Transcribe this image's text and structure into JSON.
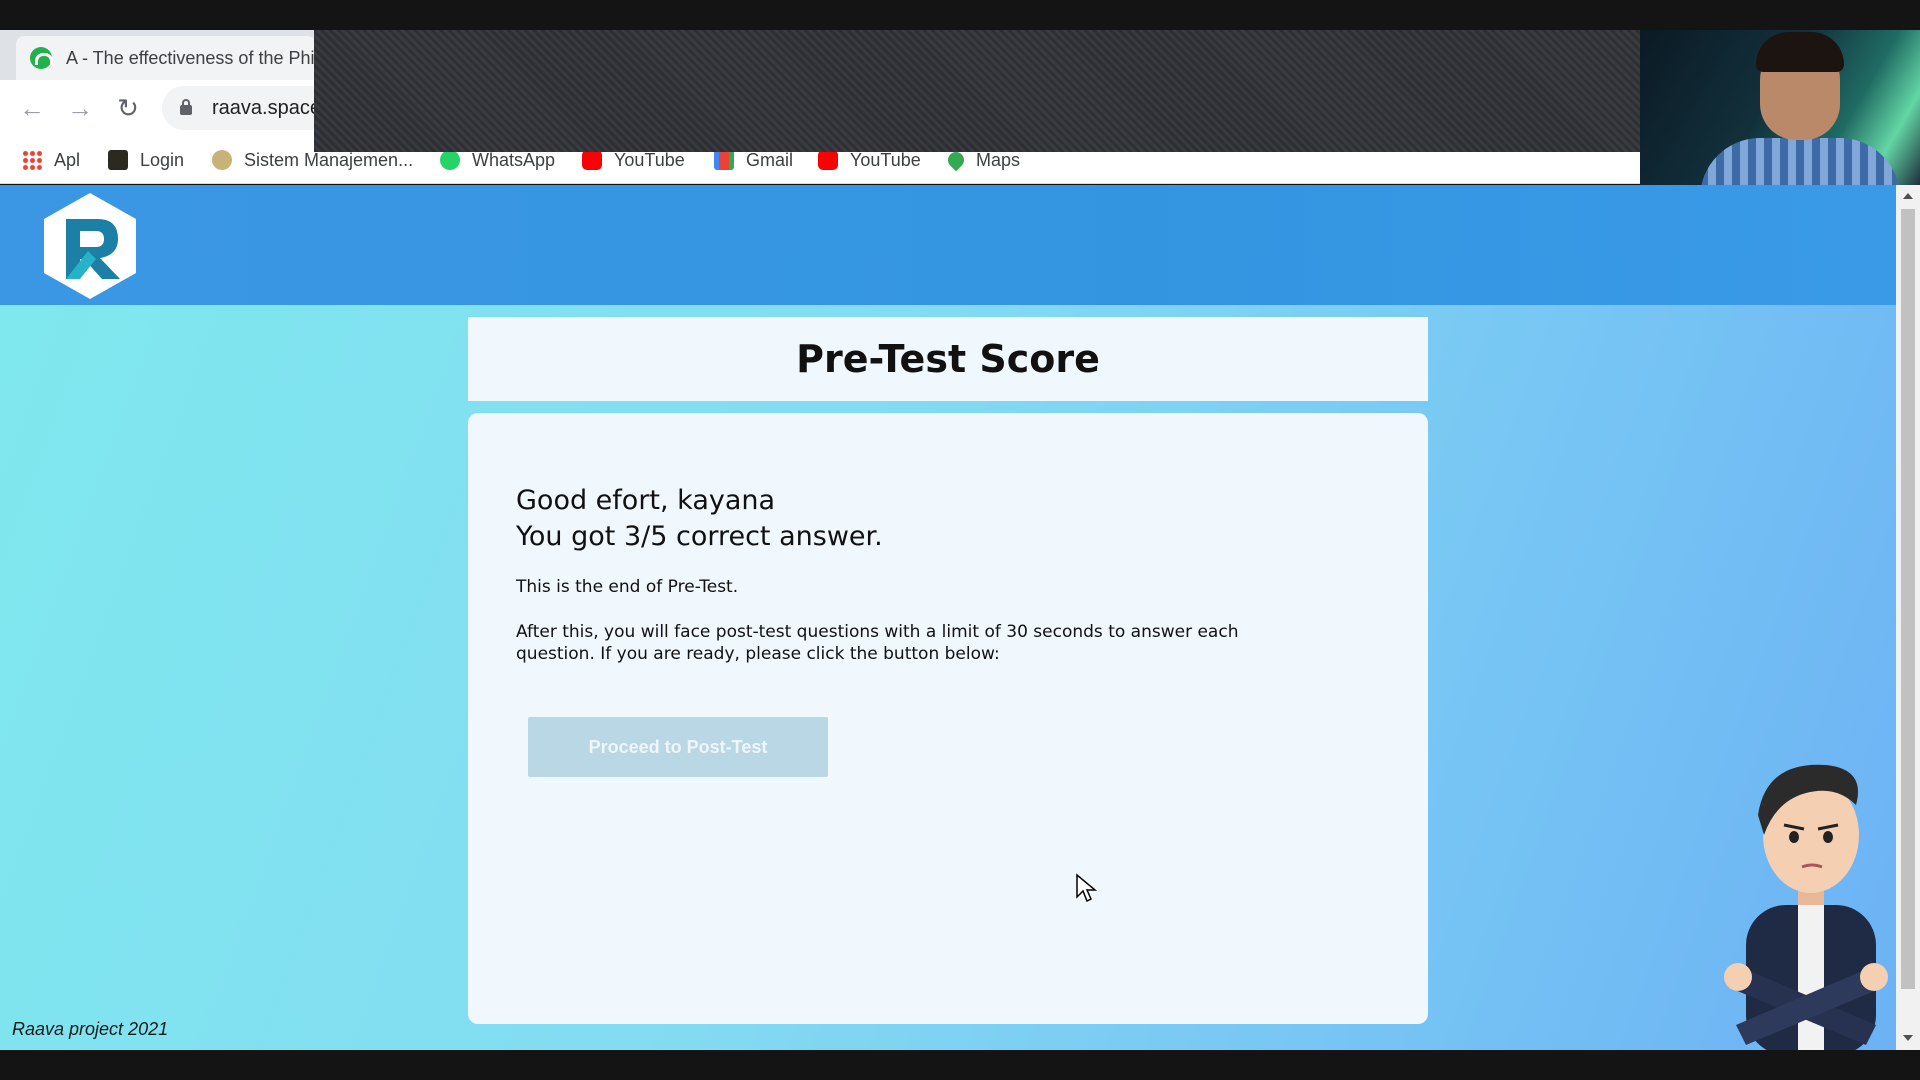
{
  "browser": {
    "tab_title": "A - The effectiveness of the Phi",
    "url": "raava.space",
    "bookmarks": [
      {
        "label": "Apl",
        "icon": "apps-grid-icon"
      },
      {
        "label": "Login",
        "icon": "login-favicon"
      },
      {
        "label": "Sistem Manajemen...",
        "icon": "sistem-favicon"
      },
      {
        "label": "WhatsApp",
        "icon": "whatsapp-icon"
      },
      {
        "label": "YouTube",
        "icon": "youtube-icon"
      },
      {
        "label": "Gmail",
        "icon": "gmail-icon"
      },
      {
        "label": "YouTube",
        "icon": "youtube-icon"
      },
      {
        "label": "Maps",
        "icon": "maps-icon"
      }
    ]
  },
  "page": {
    "title": "Pre-Test Score",
    "greeting_line1": "Good efort, kayana",
    "greeting_line2": "You got 3/5 correct answer.",
    "end_text": "This is the end of Pre-Test.",
    "instructions": "After this, you will face post-test questions with a limit of 30 seconds to answer each question. If you are ready, please click the button below:",
    "proceed_button": "Proceed to Post-Test",
    "footer": "Raava project 2021"
  },
  "colors": {
    "header": "#3395e0",
    "card": "#f0f7fd",
    "button_disabled": "#b9d7e4"
  }
}
